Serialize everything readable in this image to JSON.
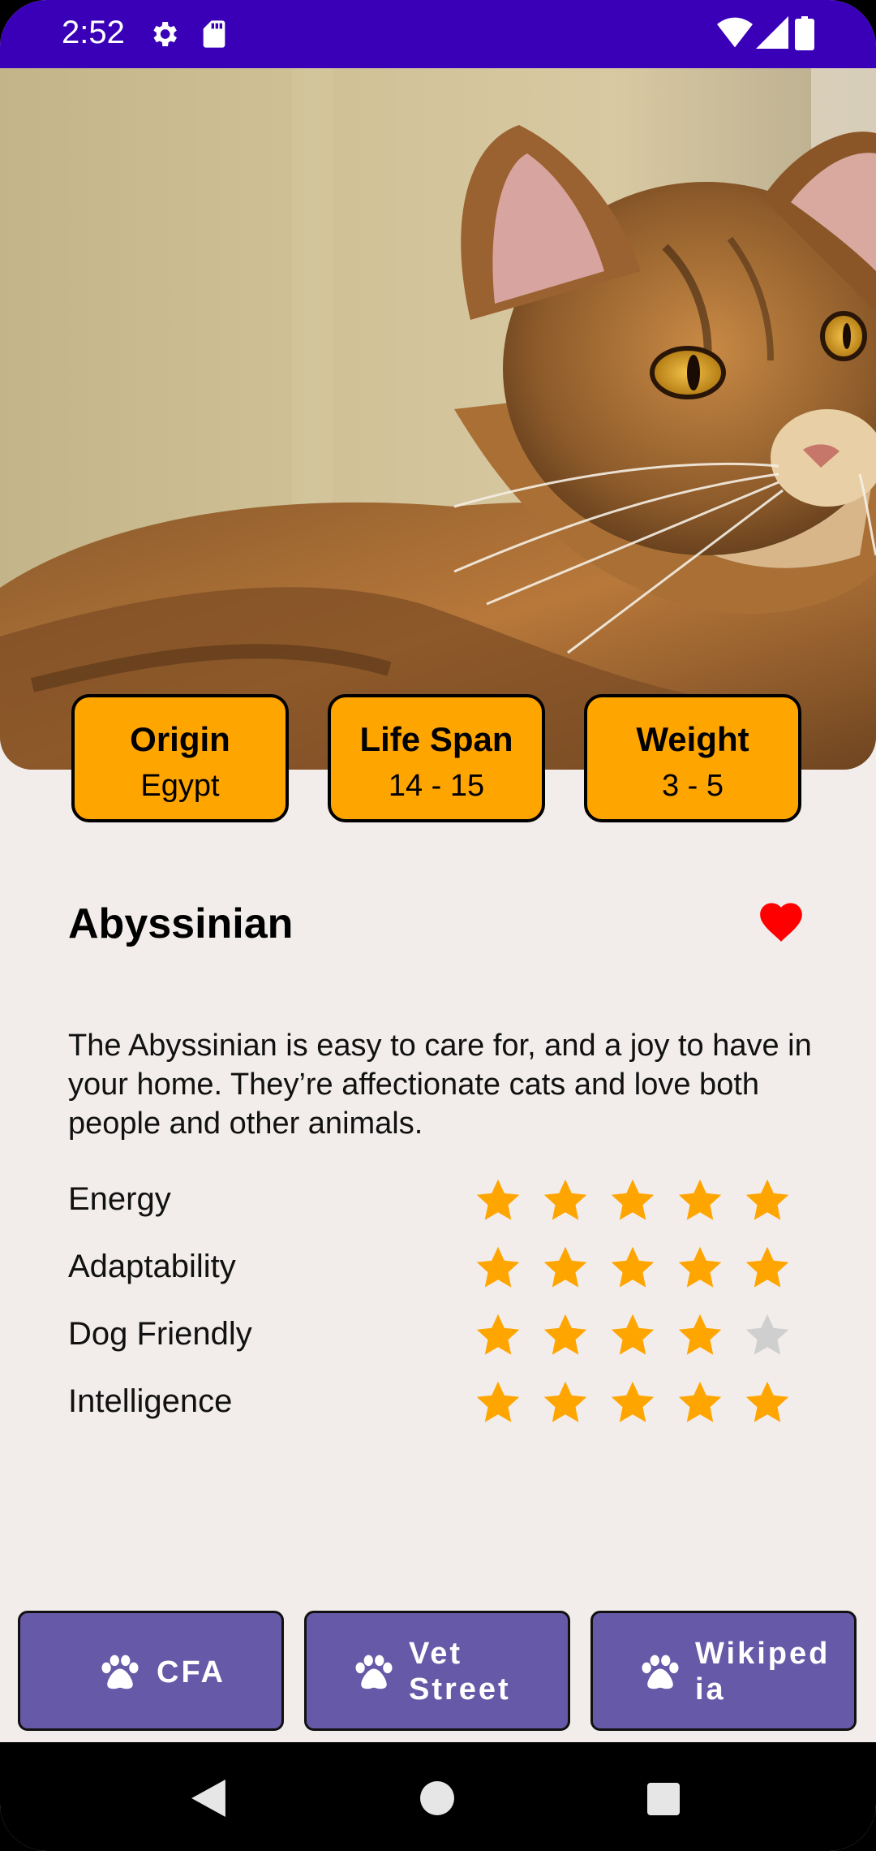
{
  "status_bar": {
    "time": "2:52",
    "icons": [
      "settings-icon",
      "sd-card-icon",
      "wifi-icon",
      "signal-icon",
      "battery-icon"
    ],
    "color": "#3a00b7"
  },
  "hero": {
    "image": "abyssinian-cat-photo"
  },
  "info": [
    {
      "title": "Origin",
      "value": "Egypt"
    },
    {
      "title": "Life Span",
      "value": "14 - 15"
    },
    {
      "title": "Weight",
      "value": "3 - 5"
    }
  ],
  "breed": {
    "name": "Abyssinian",
    "favorite": true,
    "description": "The Abyssinian is easy to care for, and a joy to have in your home. They’re affectionate cats and love both people and other animals."
  },
  "ratings": [
    {
      "label": "Energy",
      "value": 5,
      "max": 5
    },
    {
      "label": "Adaptability",
      "value": 5,
      "max": 5
    },
    {
      "label": "Dog Friendly",
      "value": 4,
      "max": 5
    },
    {
      "label": "Intelligence",
      "value": 5,
      "max": 5
    }
  ],
  "links": [
    {
      "line1": "CFA",
      "line2": ""
    },
    {
      "line1": "Vet",
      "line2": "Street"
    },
    {
      "line1": "Wikiped",
      "line2": "ia"
    }
  ],
  "colors": {
    "accent": "#ffa500",
    "button": "#6659a8",
    "heart": "#ff0000",
    "star_empty": "#cfcfcf"
  },
  "nav": [
    "back-icon",
    "home-icon",
    "recents-icon"
  ]
}
